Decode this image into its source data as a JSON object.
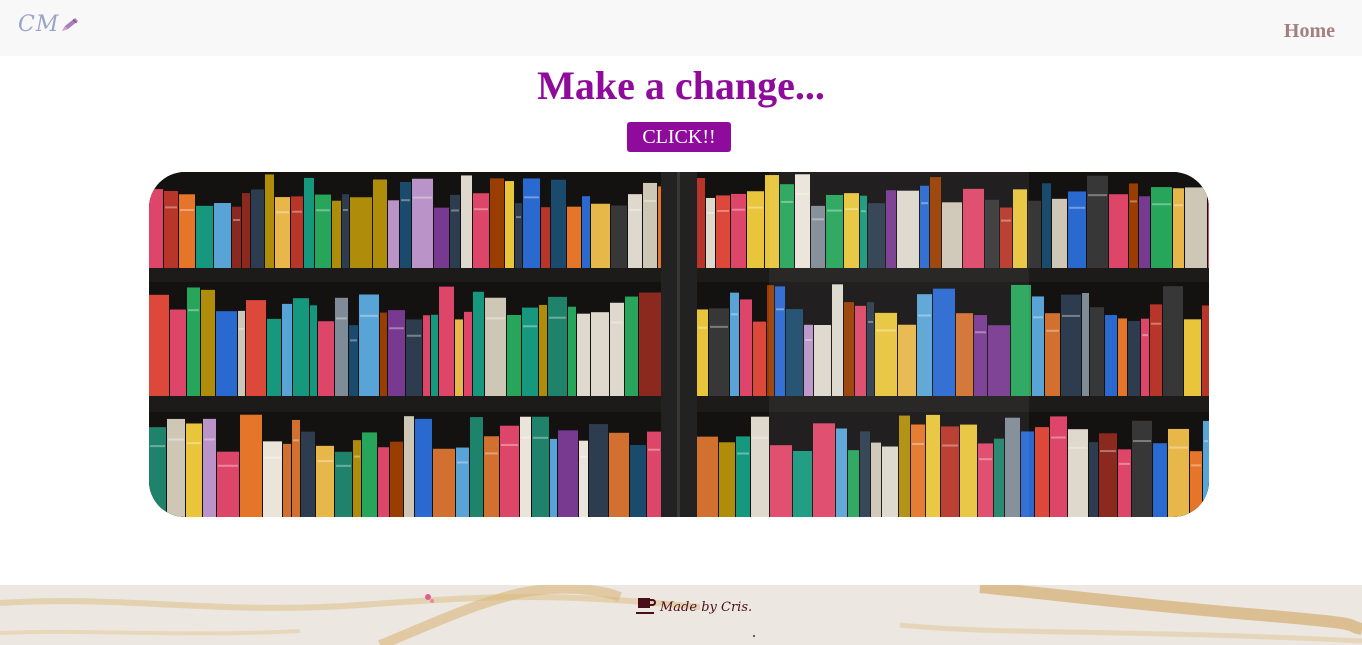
{
  "navbar": {
    "brand": "CM",
    "brand_icon": "pencil-icon",
    "links": [
      {
        "label": "Home"
      }
    ]
  },
  "hero": {
    "title": "Make a change...",
    "button_label": "CLICK!!",
    "image": "bookshelf-photo"
  },
  "footer": {
    "icon": "coffee-cup-icon",
    "credit": "Made by Cris."
  },
  "colors": {
    "accent": "#8e0b9b",
    "nav_link": "#a57f7f",
    "navbar_bg": "#f8f8f8",
    "footer_text": "#4a0d1a"
  }
}
